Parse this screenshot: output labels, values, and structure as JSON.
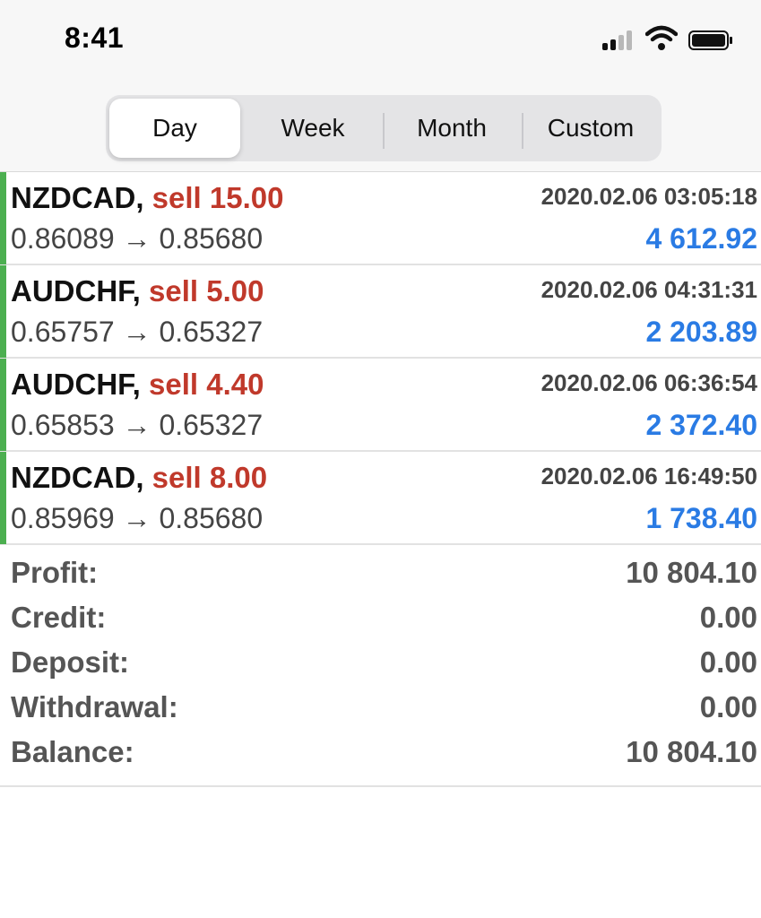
{
  "status_bar": {
    "time": "8:41",
    "icons": [
      "cellular-signal-icon",
      "wifi-icon",
      "battery-icon"
    ]
  },
  "period_tabs": {
    "items": [
      "Day",
      "Week",
      "Month",
      "Custom"
    ],
    "selected": "Day"
  },
  "trades": [
    {
      "symbol": "NZDCAD,",
      "side": "sell 15.00",
      "time": "2020.02.06 03:05:18",
      "prices": "0.86089 → 0.85680",
      "profit": "4 612.92"
    },
    {
      "symbol": "AUDCHF,",
      "side": "sell 5.00",
      "time": "2020.02.06 04:31:31",
      "prices": "0.65757 → 0.65327",
      "profit": "2 203.89"
    },
    {
      "symbol": "AUDCHF,",
      "side": "sell 4.40",
      "time": "2020.02.06 06:36:54",
      "prices": "0.65853 → 0.65327",
      "profit": "2 372.40"
    },
    {
      "symbol": "NZDCAD,",
      "side": "sell 8.00",
      "time": "2020.02.06 16:49:50",
      "prices": "0.85969 → 0.85680",
      "profit": "1 738.40"
    }
  ],
  "summary": [
    {
      "label": "Profit:",
      "value": "10 804.10"
    },
    {
      "label": "Credit:",
      "value": "0.00"
    },
    {
      "label": "Deposit:",
      "value": "0.00"
    },
    {
      "label": "Withdrawal:",
      "value": "0.00"
    },
    {
      "label": "Balance:",
      "value": "10 804.10"
    }
  ],
  "colors": {
    "sell": "#c0392b",
    "profit": "#2a7be4",
    "accent_bar": "#4caf50"
  }
}
